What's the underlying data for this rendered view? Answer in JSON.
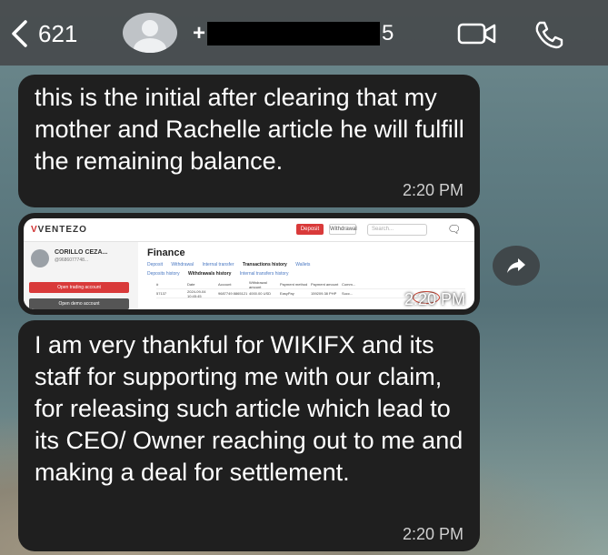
{
  "header": {
    "back_count": "621",
    "contact_prefix": "+",
    "contact_suffix": "5",
    "icons": {
      "back": "chevron-left-icon",
      "video": "video-camera-icon",
      "phone": "phone-icon",
      "avatar": "person-avatar-icon"
    }
  },
  "messages": [
    {
      "text": "this is the initial after clearing that my mother and Rachelle article he will fulfill the remaining balance.",
      "time": "2:20 PM"
    },
    {
      "type": "image",
      "time": "2:20 PM",
      "screenshot": {
        "logo": "VENTEZO",
        "deposit": "Deposit",
        "withdrawal": "Withdrawal",
        "search_placeholder": "Search...",
        "user_name": "CORILLO CEZA...",
        "user_id": "@9686077748...",
        "open_trading": "Open trading account",
        "open_demo": "Open demo account",
        "page_title": "Finance",
        "tabs": [
          "Deposit",
          "Withdrawal",
          "Internal transfer",
          "Transactions history",
          "Wallets"
        ],
        "subtabs": [
          "Deposits history",
          "Withdrawals history",
          "Internal transfers history"
        ],
        "table_headers": [
          "#",
          "Date",
          "Account",
          "Withdrawal amount",
          "Payment method",
          "Payment amount",
          "Comm..."
        ],
        "table_row": [
          "57137",
          "2024-09-04 10:45:45",
          "9687749 8865121",
          "4000.00 USD",
          "EasyPay",
          "159209.38 PHP",
          "Succ..."
        ]
      }
    },
    {
      "text": "I am very thankful for WIKIFX and its staff for supporting me with our claim, for releasing such article which lead to its CEO/ Owner reaching out to me and making a deal for settlement.",
      "time": "2:20 PM"
    }
  ],
  "forward_icon": "share-forward-icon",
  "colors": {
    "bubble": "#1f1f1f",
    "header": "#464a4c",
    "accent_red": "#d93a3a"
  }
}
